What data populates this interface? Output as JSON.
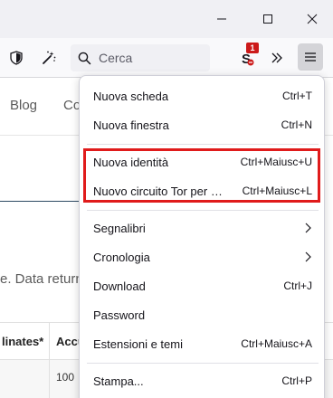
{
  "window": {
    "controls": [
      "minimize",
      "maximize",
      "close"
    ]
  },
  "toolbar": {
    "search": {
      "placeholder": "Cerca"
    },
    "extension_badge": "1",
    "icons": [
      "shield-icon",
      "magic-wand-icon",
      "search-icon",
      "extension-icon",
      "overflow-chevrons-icon",
      "hamburger-menu-icon"
    ]
  },
  "page": {
    "nav": [
      "Blog",
      "Co"
    ],
    "text": "e. Data returne",
    "table": {
      "headers": [
        "linates*",
        "Accu"
      ],
      "row": [
        "",
        "100"
      ]
    }
  },
  "menu": {
    "items": [
      {
        "label": "Nuova scheda",
        "shortcut": "Ctrl+T"
      },
      {
        "label": "Nuova finestra",
        "shortcut": "Ctrl+N"
      },
      {
        "label": "Nuova identità",
        "shortcut": "Ctrl+Maiusc+U"
      },
      {
        "label": "Nuovo circuito Tor per qu...",
        "shortcut": "Ctrl+Maiusc+L"
      },
      {
        "label": "Segnalibri",
        "shortcut": ""
      },
      {
        "label": "Cronologia",
        "shortcut": ""
      },
      {
        "label": "Download",
        "shortcut": "Ctrl+J"
      },
      {
        "label": "Password",
        "shortcut": ""
      },
      {
        "label": "Estensioni e temi",
        "shortcut": "Ctrl+Maiusc+A"
      },
      {
        "label": "Stampa...",
        "shortcut": "Ctrl+P"
      }
    ],
    "highlight_color": "#e01b1b"
  }
}
